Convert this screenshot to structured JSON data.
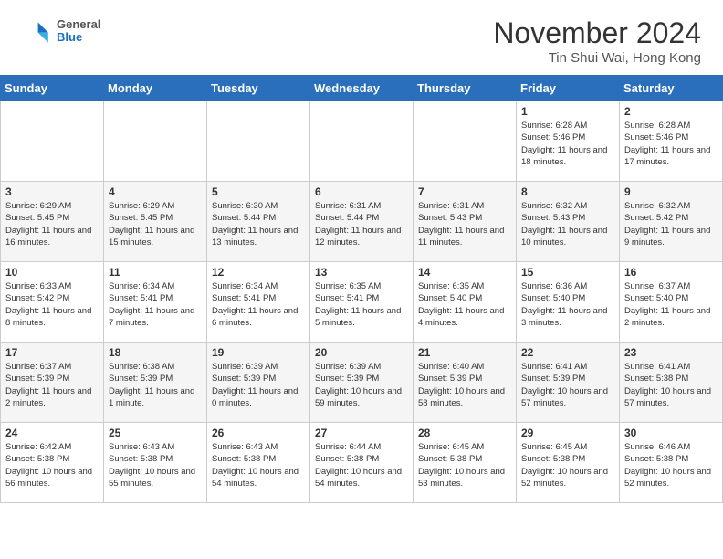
{
  "header": {
    "logo": {
      "general": "General",
      "blue": "Blue"
    },
    "month_title": "November 2024",
    "location": "Tin Shui Wai, Hong Kong"
  },
  "weekdays": [
    "Sunday",
    "Monday",
    "Tuesday",
    "Wednesday",
    "Thursday",
    "Friday",
    "Saturday"
  ],
  "weeks": [
    [
      {
        "day": "",
        "info": ""
      },
      {
        "day": "",
        "info": ""
      },
      {
        "day": "",
        "info": ""
      },
      {
        "day": "",
        "info": ""
      },
      {
        "day": "",
        "info": ""
      },
      {
        "day": "1",
        "info": "Sunrise: 6:28 AM\nSunset: 5:46 PM\nDaylight: 11 hours and 18 minutes."
      },
      {
        "day": "2",
        "info": "Sunrise: 6:28 AM\nSunset: 5:46 PM\nDaylight: 11 hours and 17 minutes."
      }
    ],
    [
      {
        "day": "3",
        "info": "Sunrise: 6:29 AM\nSunset: 5:45 PM\nDaylight: 11 hours and 16 minutes."
      },
      {
        "day": "4",
        "info": "Sunrise: 6:29 AM\nSunset: 5:45 PM\nDaylight: 11 hours and 15 minutes."
      },
      {
        "day": "5",
        "info": "Sunrise: 6:30 AM\nSunset: 5:44 PM\nDaylight: 11 hours and 13 minutes."
      },
      {
        "day": "6",
        "info": "Sunrise: 6:31 AM\nSunset: 5:44 PM\nDaylight: 11 hours and 12 minutes."
      },
      {
        "day": "7",
        "info": "Sunrise: 6:31 AM\nSunset: 5:43 PM\nDaylight: 11 hours and 11 minutes."
      },
      {
        "day": "8",
        "info": "Sunrise: 6:32 AM\nSunset: 5:43 PM\nDaylight: 11 hours and 10 minutes."
      },
      {
        "day": "9",
        "info": "Sunrise: 6:32 AM\nSunset: 5:42 PM\nDaylight: 11 hours and 9 minutes."
      }
    ],
    [
      {
        "day": "10",
        "info": "Sunrise: 6:33 AM\nSunset: 5:42 PM\nDaylight: 11 hours and 8 minutes."
      },
      {
        "day": "11",
        "info": "Sunrise: 6:34 AM\nSunset: 5:41 PM\nDaylight: 11 hours and 7 minutes."
      },
      {
        "day": "12",
        "info": "Sunrise: 6:34 AM\nSunset: 5:41 PM\nDaylight: 11 hours and 6 minutes."
      },
      {
        "day": "13",
        "info": "Sunrise: 6:35 AM\nSunset: 5:41 PM\nDaylight: 11 hours and 5 minutes."
      },
      {
        "day": "14",
        "info": "Sunrise: 6:35 AM\nSunset: 5:40 PM\nDaylight: 11 hours and 4 minutes."
      },
      {
        "day": "15",
        "info": "Sunrise: 6:36 AM\nSunset: 5:40 PM\nDaylight: 11 hours and 3 minutes."
      },
      {
        "day": "16",
        "info": "Sunrise: 6:37 AM\nSunset: 5:40 PM\nDaylight: 11 hours and 2 minutes."
      }
    ],
    [
      {
        "day": "17",
        "info": "Sunrise: 6:37 AM\nSunset: 5:39 PM\nDaylight: 11 hours and 2 minutes."
      },
      {
        "day": "18",
        "info": "Sunrise: 6:38 AM\nSunset: 5:39 PM\nDaylight: 11 hours and 1 minute."
      },
      {
        "day": "19",
        "info": "Sunrise: 6:39 AM\nSunset: 5:39 PM\nDaylight: 11 hours and 0 minutes."
      },
      {
        "day": "20",
        "info": "Sunrise: 6:39 AM\nSunset: 5:39 PM\nDaylight: 10 hours and 59 minutes."
      },
      {
        "day": "21",
        "info": "Sunrise: 6:40 AM\nSunset: 5:39 PM\nDaylight: 10 hours and 58 minutes."
      },
      {
        "day": "22",
        "info": "Sunrise: 6:41 AM\nSunset: 5:39 PM\nDaylight: 10 hours and 57 minutes."
      },
      {
        "day": "23",
        "info": "Sunrise: 6:41 AM\nSunset: 5:38 PM\nDaylight: 10 hours and 57 minutes."
      }
    ],
    [
      {
        "day": "24",
        "info": "Sunrise: 6:42 AM\nSunset: 5:38 PM\nDaylight: 10 hours and 56 minutes."
      },
      {
        "day": "25",
        "info": "Sunrise: 6:43 AM\nSunset: 5:38 PM\nDaylight: 10 hours and 55 minutes."
      },
      {
        "day": "26",
        "info": "Sunrise: 6:43 AM\nSunset: 5:38 PM\nDaylight: 10 hours and 54 minutes."
      },
      {
        "day": "27",
        "info": "Sunrise: 6:44 AM\nSunset: 5:38 PM\nDaylight: 10 hours and 54 minutes."
      },
      {
        "day": "28",
        "info": "Sunrise: 6:45 AM\nSunset: 5:38 PM\nDaylight: 10 hours and 53 minutes."
      },
      {
        "day": "29",
        "info": "Sunrise: 6:45 AM\nSunset: 5:38 PM\nDaylight: 10 hours and 52 minutes."
      },
      {
        "day": "30",
        "info": "Sunrise: 6:46 AM\nSunset: 5:38 PM\nDaylight: 10 hours and 52 minutes."
      }
    ]
  ]
}
